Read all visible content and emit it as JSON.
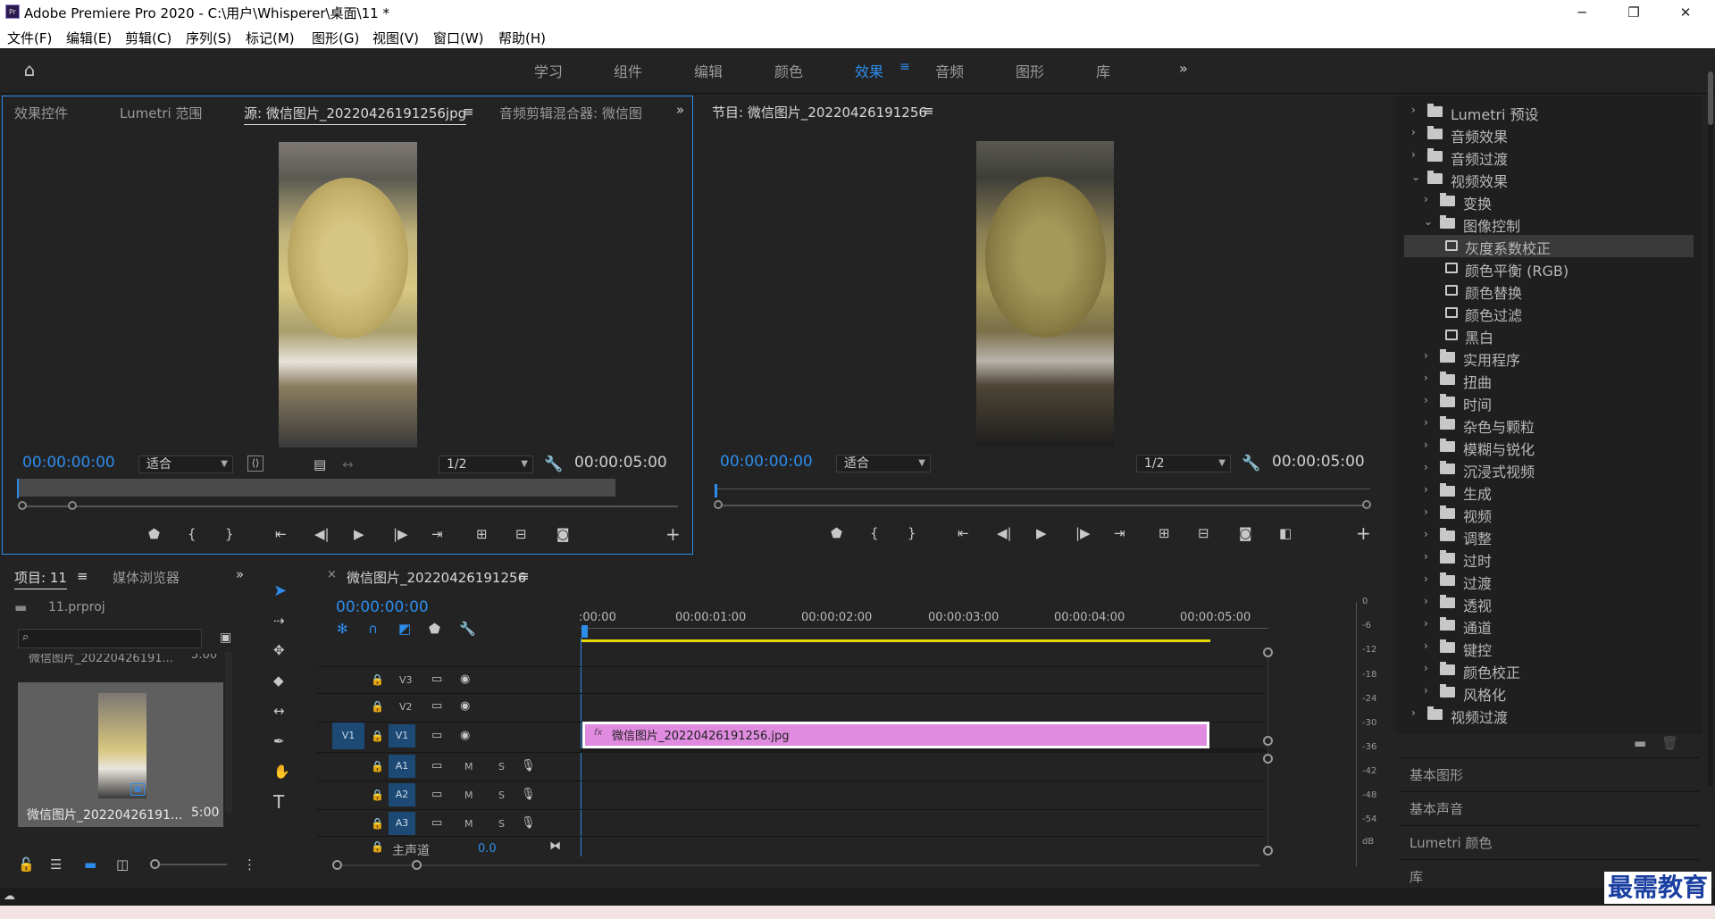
{
  "app": {
    "title": "Adobe Premiere Pro 2020 - C:\\用户\\Whisperer\\桌面\\11 *",
    "icon_text": "Pr"
  },
  "window_buttons": {
    "minimize": "─",
    "maximize": "❐",
    "close": "✕"
  },
  "menu": [
    "文件(F)",
    "编辑(E)",
    "剪辑(C)",
    "序列(S)",
    "标记(M)",
    "图形(G)",
    "视图(V)",
    "窗口(W)",
    "帮助(H)"
  ],
  "workspaces": [
    "学习",
    "组件",
    "编辑",
    "颜色",
    "效果",
    "音频",
    "图形",
    "库"
  ],
  "workspace_active": "效果",
  "source_panel": {
    "tabs": [
      "效果控件",
      "Lumetri 范围",
      "源: 微信图片_20220426191256jpg",
      "音频剪辑混合器: 微信图"
    ],
    "timecode": "00:00:00:00",
    "fit": "适合",
    "resolution": "1/2",
    "duration": "00:00:05:00"
  },
  "program_panel": {
    "tab": "节目: 微信图片_20220426191256",
    "timecode": "00:00:00:00",
    "fit": "适合",
    "resolution": "1/2",
    "duration": "00:00:05:00"
  },
  "effects_tree": [
    {
      "label": "Lumetri 预设",
      "level": 0,
      "expanded": false
    },
    {
      "label": "音频效果",
      "level": 0,
      "expanded": false
    },
    {
      "label": "音频过渡",
      "level": 0,
      "expanded": false
    },
    {
      "label": "视频效果",
      "level": 0,
      "expanded": true
    },
    {
      "label": "变换",
      "level": 1,
      "expanded": false
    },
    {
      "label": "图像控制",
      "level": 1,
      "expanded": true
    },
    {
      "label": "灰度系数校正",
      "level": 2,
      "selected": true
    },
    {
      "label": "颜色平衡 (RGB)",
      "level": 2
    },
    {
      "label": "颜色替换",
      "level": 2
    },
    {
      "label": "颜色过滤",
      "level": 2
    },
    {
      "label": "黑白",
      "level": 2
    },
    {
      "label": "实用程序",
      "level": 1,
      "expanded": false
    },
    {
      "label": "扭曲",
      "level": 1,
      "expanded": false
    },
    {
      "label": "时间",
      "level": 1,
      "expanded": false
    },
    {
      "label": "杂色与颗粒",
      "level": 1,
      "expanded": false
    },
    {
      "label": "模糊与锐化",
      "level": 1,
      "expanded": false
    },
    {
      "label": "沉浸式视频",
      "level": 1,
      "expanded": false
    },
    {
      "label": "生成",
      "level": 1,
      "expanded": false
    },
    {
      "label": "视频",
      "level": 1,
      "expanded": false
    },
    {
      "label": "调整",
      "level": 1,
      "expanded": false
    },
    {
      "label": "过时",
      "level": 1,
      "expanded": false
    },
    {
      "label": "过渡",
      "level": 1,
      "expanded": false
    },
    {
      "label": "透视",
      "level": 1,
      "expanded": false
    },
    {
      "label": "通道",
      "level": 1,
      "expanded": false
    },
    {
      "label": "键控",
      "level": 1,
      "expanded": false
    },
    {
      "label": "颜色校正",
      "level": 1,
      "expanded": false
    },
    {
      "label": "风格化",
      "level": 1,
      "expanded": false
    },
    {
      "label": "视频过渡",
      "level": 0,
      "expanded": false
    }
  ],
  "side_panels": [
    "基本图形",
    "基本声音",
    "Lumetri 颜色",
    "库"
  ],
  "project_panel": {
    "tabs": [
      "项目: 11",
      "媒体浏览器"
    ],
    "project_file": "11.prproj",
    "clip_name": "微信图片_20220426191...",
    "clip_duration": "5:00",
    "clip_name_top": "微信图片_20220426191...",
    "clip_duration_top": "5:00"
  },
  "timeline": {
    "tab": "微信图片_20220426191256",
    "timecode": "00:00:00:00",
    "ruler": [
      ":00:00",
      "00:00:01:00",
      "00:00:02:00",
      "00:00:03:00",
      "00:00:04:00",
      "00:00:05:00"
    ],
    "video_tracks": [
      "V3",
      "V2",
      "V1"
    ],
    "audio_tracks": [
      "A1",
      "A2",
      "A3"
    ],
    "source_patch": "V1",
    "clip_label": "微信图片_20220426191256.jpg",
    "clip_fx": "fx",
    "master_label": "主声道",
    "master_value": "0.0",
    "mute": "M",
    "solo": "S"
  },
  "audio_meter": {
    "ticks": [
      "0",
      "-6",
      "-12",
      "-18",
      "-24",
      "-30",
      "-36",
      "-42",
      "-48",
      "-54",
      "dB"
    ]
  },
  "watermark": "最需教育",
  "colors": {
    "accent": "#2d8ceb",
    "clip": "#e08be0",
    "track_active": "#1d4a74",
    "work_area": "#e8d800"
  }
}
